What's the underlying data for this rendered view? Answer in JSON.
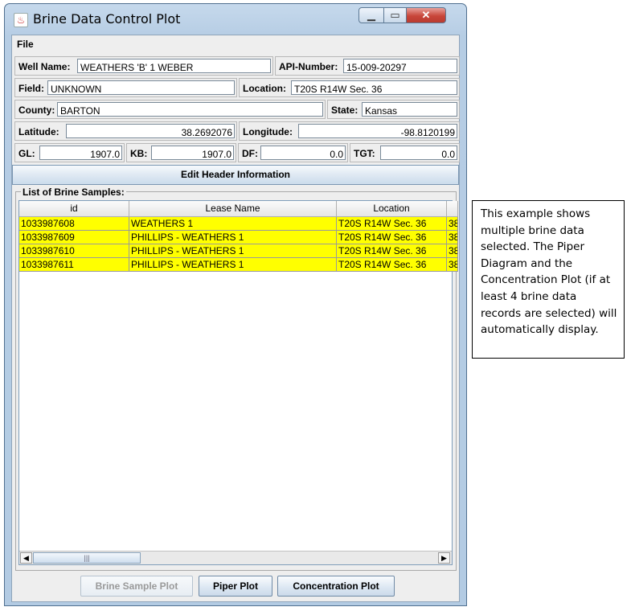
{
  "window": {
    "title": "Brine Data Control Plot"
  },
  "menu": {
    "file": "File"
  },
  "header": {
    "well_name_label": "Well Name:",
    "well_name": "WEATHERS 'B' 1 WEBER",
    "api_label": "API-Number:",
    "api": "15-009-20297",
    "field_label": "Field:",
    "field": "UNKNOWN",
    "location_label": "Location:",
    "location": "T20S R14W Sec. 36",
    "county_label": "County:",
    "county": "BARTON",
    "state_label": "State:",
    "state": "Kansas",
    "latitude_label": "Latitude:",
    "latitude": "38.2692076",
    "longitude_label": "Longitude:",
    "longitude": "-98.8120199",
    "gl_label": "GL:",
    "gl": "1907.0",
    "kb_label": "KB:",
    "kb": "1907.0",
    "df_label": "DF:",
    "df": "0.0",
    "tgt_label": "TGT:",
    "tgt": "0.0"
  },
  "edit_header_button": "Edit Header Information",
  "samples": {
    "title": "List of Brine Samples:",
    "columns": [
      "id",
      "Lease Name",
      "Location"
    ],
    "rows": [
      {
        "id": "1033987608",
        "lease": "WEATHERS 1",
        "location": "T20S R14W Sec. 36",
        "extra": "38"
      },
      {
        "id": "1033987609",
        "lease": "PHILLIPS - WEATHERS 1",
        "location": "T20S R14W Sec. 36",
        "extra": "38"
      },
      {
        "id": "1033987610",
        "lease": "PHILLIPS - WEATHERS 1",
        "location": "T20S R14W Sec. 36",
        "extra": "38"
      },
      {
        "id": "1033987611",
        "lease": "PHILLIPS - WEATHERS 1",
        "location": "T20S R14W Sec. 36",
        "extra": "38"
      }
    ]
  },
  "buttons": {
    "brine_sample_plot": "Brine Sample Plot",
    "piper_plot": "Piper Plot",
    "concentration_plot": "Concentration Plot"
  },
  "callout": {
    "text": "This example shows multiple brine data selected.  The Piper Diagram and the Concentration Plot (if at least 4 brine data records are selected) will automatically display."
  },
  "colors": {
    "selection": "#ffff00",
    "title_bar": "#b6cde4"
  }
}
